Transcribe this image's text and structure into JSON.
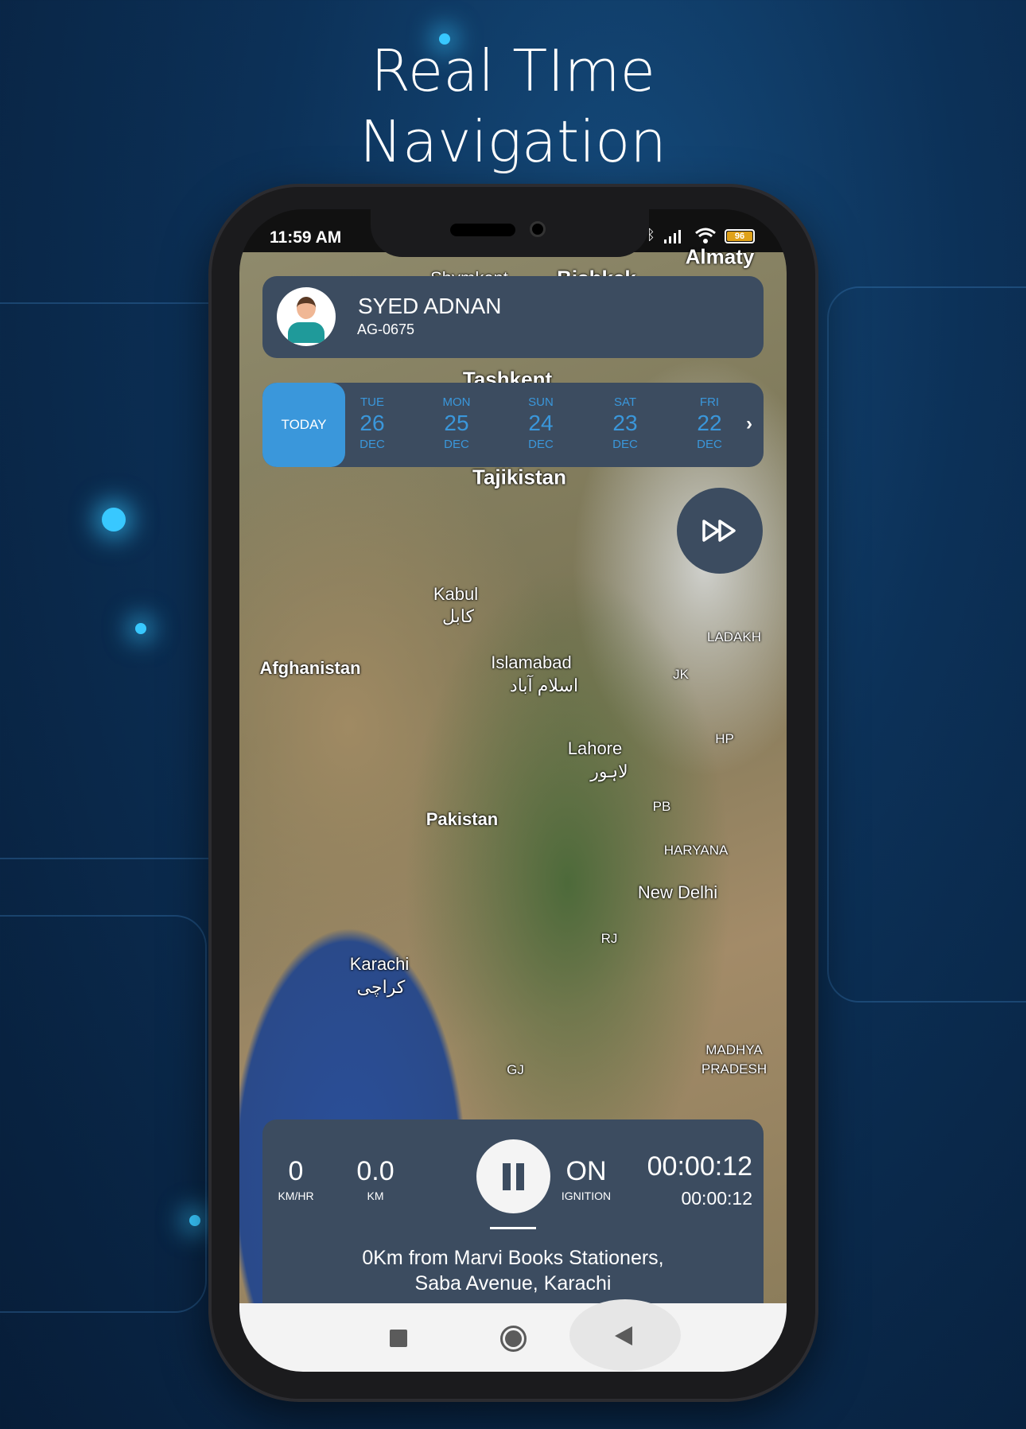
{
  "promo": {
    "title_line1": "Real TIme",
    "title_line2": "Navigation"
  },
  "status_bar": {
    "time": "11:59 AM",
    "battery": "96",
    "icons": [
      "bluetooth-icon",
      "signal-icon",
      "wifi-icon",
      "battery-icon"
    ]
  },
  "profile": {
    "name": "SYED ADNAN",
    "vehicle_id": "AG-0675",
    "avatar": "driver-avatar"
  },
  "dates": {
    "today_label": "TODAY",
    "items": [
      {
        "day": "TUE",
        "date": "26",
        "month": "DEC"
      },
      {
        "day": "MON",
        "date": "25",
        "month": "DEC"
      },
      {
        "day": "SUN",
        "date": "24",
        "month": "DEC"
      },
      {
        "day": "SAT",
        "date": "23",
        "month": "DEC"
      },
      {
        "day": "FRI",
        "date": "22",
        "month": "DEC"
      }
    ],
    "accent": "#3a97db"
  },
  "map_labels": {
    "shymkent": "Shymkent",
    "bishkek": "Bishkek",
    "almaty": "Almaty",
    "tashkent": "Tashkent",
    "tajikistan": "Tajikistan",
    "kabul": "Kabul",
    "kabul_ur": "کابل",
    "afghanistan": "Afghanistan",
    "islamabad": "Islamabad",
    "islamabad_ur": "اسلام آباد",
    "ladakh": "LADAKH",
    "jk": "JK",
    "hp": "HP",
    "lahore": "Lahore",
    "lahore_ur": "لاہور",
    "pb": "PB",
    "pakistan": "Pakistan",
    "haryana": "HARYANA",
    "new_delhi": "New Delhi",
    "rj": "RJ",
    "karachi": "Karachi",
    "karachi_ur": "کراچی",
    "gj": "GJ",
    "madhya": "MADHYA",
    "pradesh": "PRADESH"
  },
  "trip": {
    "speed": "0",
    "speed_unit": "KM/HR",
    "distance": "0.0",
    "distance_unit": "KM",
    "ignition": "ON",
    "ignition_label": "IGNITION",
    "duration": "00:00:12",
    "duration_sub": "00:00:12",
    "address_line1": "0Km from Marvi Books Stationers,",
    "address_line2": "Saba Avenue, Karachi"
  }
}
